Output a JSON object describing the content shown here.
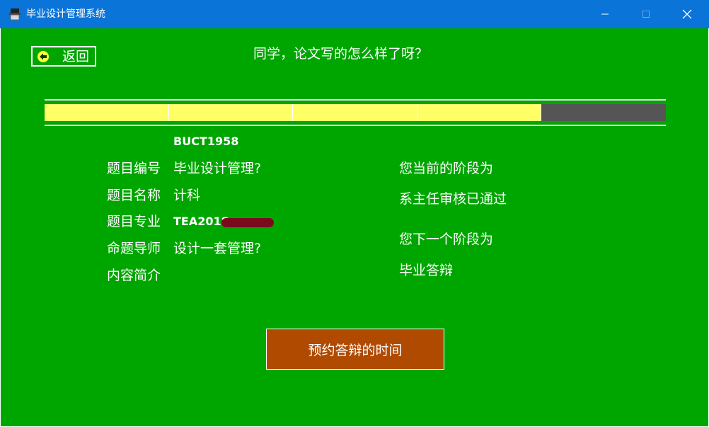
{
  "window": {
    "title": "毕业设计管理系统",
    "icon": "graduation-app-icon",
    "controls": [
      "minimize-icon",
      "maximize-icon",
      "close-icon"
    ]
  },
  "header": {
    "back_label": "返回",
    "greeting": "同学，论文写的怎么样了呀？"
  },
  "progress": {
    "segments_total": 5,
    "segments_completed": 4,
    "completed_color": "#ffff66",
    "remaining_color": "#555555"
  },
  "topic": {
    "id_value": "BUCT1958",
    "fields": [
      {
        "label": "题目编号",
        "value": "毕业设计管理?"
      },
      {
        "label": "题目名称",
        "value": "计科"
      },
      {
        "label": "题目专业",
        "value": "TEA2018"
      },
      {
        "label": "命题导师",
        "value": "设计一套管理?"
      },
      {
        "label": "内容简介",
        "value": ""
      }
    ]
  },
  "stage": {
    "current_label": "您当前的阶段为",
    "current_value": "系主任审核已通过",
    "next_label": "您下一个阶段为",
    "next_value": "毕业答辩"
  },
  "actions": {
    "reserve_label": "预约答辩的时间"
  },
  "colors": {
    "background": "#00a600",
    "titlebar": "#0a74d8",
    "button": "#b04a00"
  }
}
